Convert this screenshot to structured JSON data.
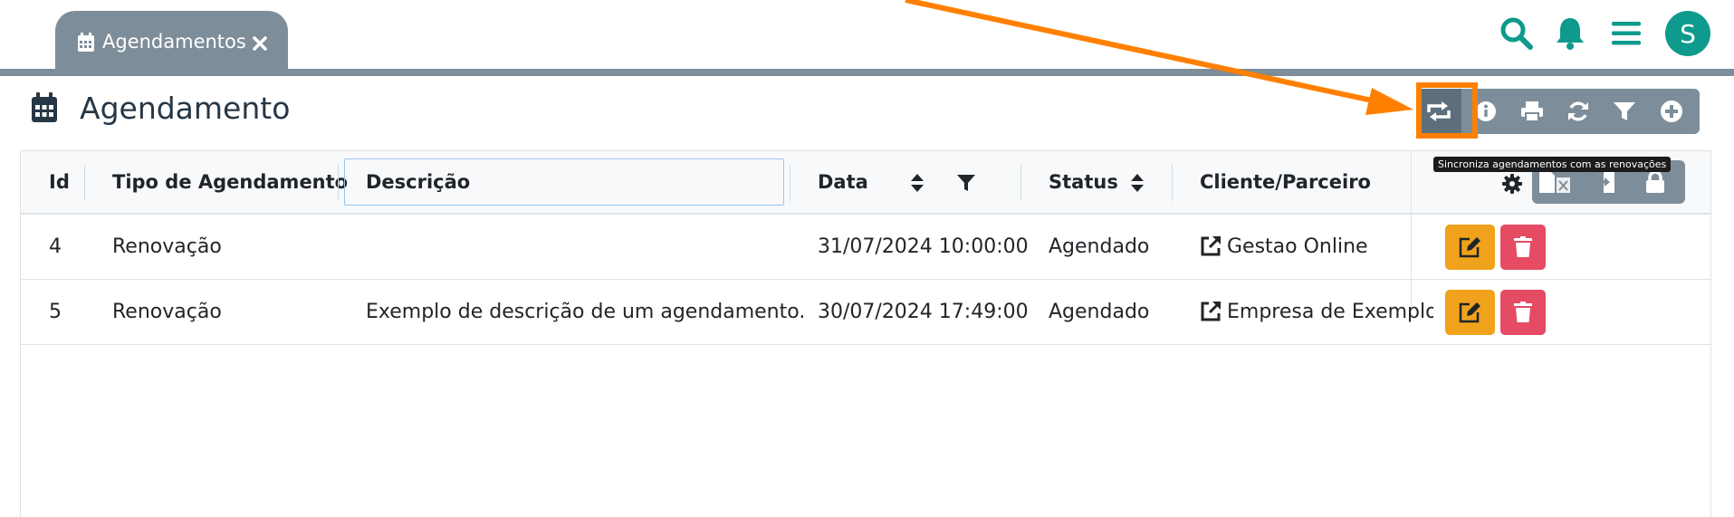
{
  "tab": {
    "label": "Agendamentos"
  },
  "header": {
    "avatar_letter": "S"
  },
  "page": {
    "title": "Agendamento"
  },
  "toolbar": {
    "tooltip": "Sincroniza agendamentos com as renovações",
    "buttons": [
      "sync-renewals-icon",
      "info-icon",
      "print-icon",
      "refresh-icon",
      "filter-icon",
      "add-icon"
    ]
  },
  "table": {
    "columns": {
      "id": "Id",
      "tipo": "Tipo de Agendamento",
      "descricao": "Descrição",
      "data": "Data",
      "status": "Status",
      "cliente": "Cliente/Parceiro"
    },
    "rows": [
      {
        "id": "4",
        "tipo": "Renovação",
        "descricao": "",
        "data": "31/07/2024 10:00:00",
        "status": "Agendado",
        "cliente": "Gestao Online"
      },
      {
        "id": "5",
        "tipo": "Renovação",
        "descricao": "Exemplo de descrição de um agendamento.",
        "data": "30/07/2024 17:49:00",
        "status": "Agendado",
        "cliente": "Empresa de Exemplo"
      }
    ]
  },
  "colors": {
    "accent": "#0e9a8c",
    "toolbar_bg": "#7d8d99",
    "highlight": "#ff8000",
    "edit": "#f0a21d",
    "delete": "#e54b63"
  }
}
